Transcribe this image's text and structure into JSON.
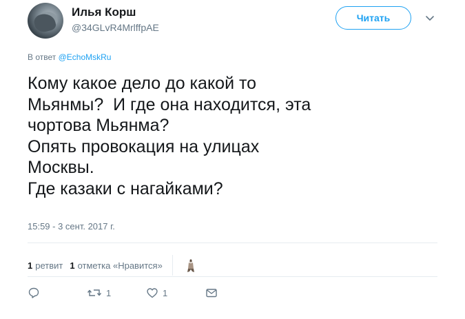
{
  "user": {
    "display_name": "Илья Корш",
    "handle": "@34GLvR4MrlffpAE"
  },
  "follow_button_label": "Читать",
  "reply_context": {
    "prefix": "В ответ",
    "mention": "@EchoMskRu"
  },
  "tweet": {
    "lines": [
      "Кому какое дело до какой то",
      "Мьянмы?  И где она находится, эта",
      "чортова Мьянма?",
      "Опять провокация на улицах",
      "Москвы.",
      "Где казаки с нагайками?"
    ],
    "timestamp": "15:59 - 3 сент. 2017 г."
  },
  "stats": {
    "retweets_count": "1",
    "retweets_label": "ретвит",
    "likes_count": "1",
    "likes_label": "отметка «Нравится»"
  },
  "actions": {
    "reply_count": "",
    "retweet_count": "1",
    "like_count": "1"
  },
  "colors": {
    "accent": "#1da1f2",
    "text": "#14171a",
    "secondary": "#657786",
    "divider": "#e6ecf0"
  },
  "icons": [
    "caret-down-icon",
    "reply-icon",
    "retweet-icon",
    "like-icon",
    "message-icon"
  ]
}
